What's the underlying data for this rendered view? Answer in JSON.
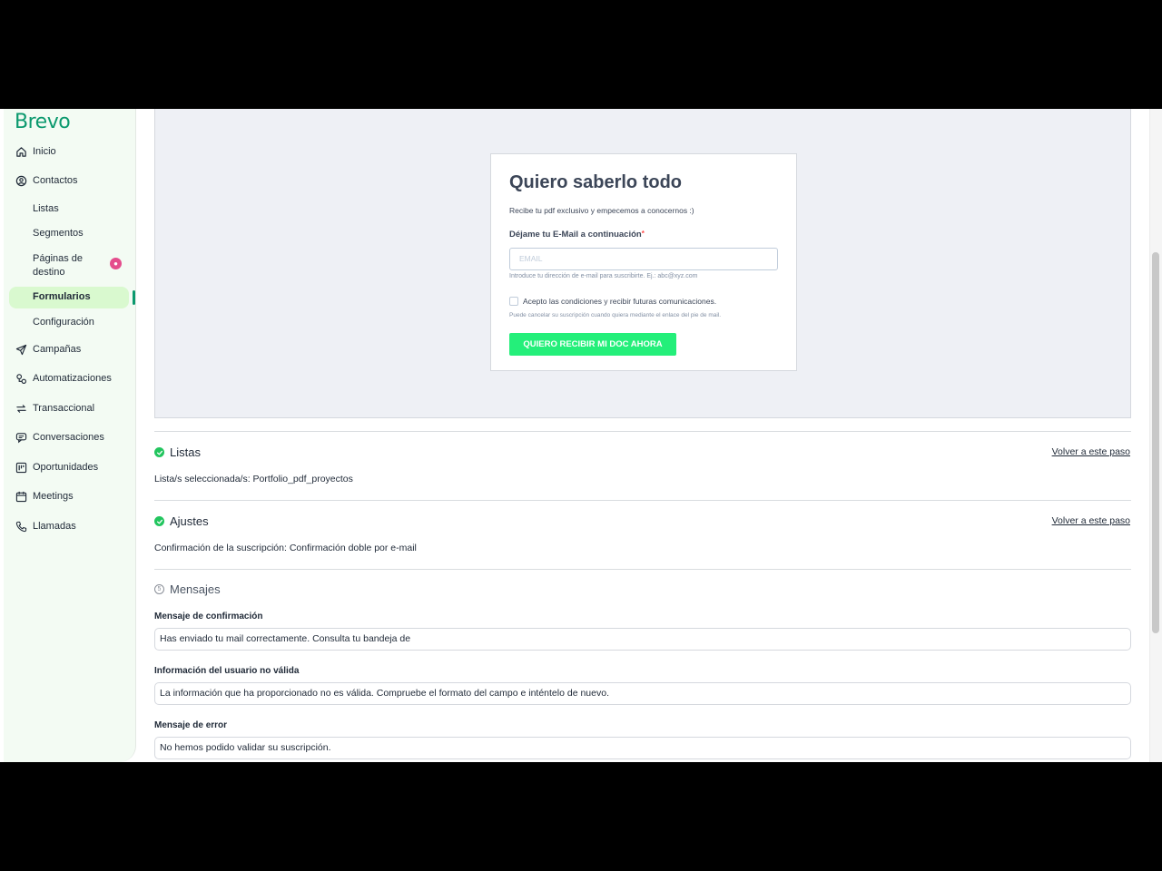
{
  "sidebar": {
    "logo": "Brevo",
    "items": [
      {
        "label": "Inicio",
        "icon": "home-icon"
      },
      {
        "label": "Contactos",
        "icon": "contacts-icon"
      },
      {
        "label": "Campañas",
        "icon": "send-icon"
      },
      {
        "label": "Automatizaciones",
        "icon": "automation-icon"
      },
      {
        "label": "Transaccional",
        "icon": "transactional-icon"
      },
      {
        "label": "Conversaciones",
        "icon": "chat-icon"
      },
      {
        "label": "Oportunidades",
        "icon": "deals-icon"
      },
      {
        "label": "Meetings",
        "icon": "calendar-icon"
      },
      {
        "label": "Llamadas",
        "icon": "phone-icon"
      }
    ],
    "contact_subitems": [
      "Listas",
      "Segmentos",
      "Páginas de destino",
      "Formularios",
      "Configuración"
    ],
    "active_item": "Formularios",
    "accent_color": "#0b996e"
  },
  "preview": {
    "title": "Quiero saberlo todo",
    "subtitle": "Recibe tu pdf exclusivo y empecemos a conocernos :)",
    "email_label": "Déjame tu E-Mail a continuación",
    "required_mark": "*",
    "email_placeholder": "EMAIL",
    "email_help": "Introduce tu dirección de e-mail para suscribirte. Ej.: abc@xyz.com",
    "checkbox_label": "Acepto las condiciones y recibir futuras comunicaciones.",
    "checkbox_help": "Puede cancelar su suscripción cuando quiera mediante el enlace del pie de mail.",
    "submit_label": "QUIERO RECIBIR MI DOC AHORA",
    "button_color": "#24ef7a"
  },
  "sections": {
    "listas": {
      "title": "Listas",
      "back_link": "Volver a este paso",
      "text": "Lista/s seleccionada/s: Portfolio_pdf_proyectos"
    },
    "ajustes": {
      "title": "Ajustes",
      "back_link": "Volver a este paso",
      "text": "Confirmación de la suscripción: Confirmación doble por e-mail"
    },
    "mensajes": {
      "number": "5",
      "title": "Mensajes",
      "fields": [
        {
          "label": "Mensaje de confirmación",
          "value": "Has enviado tu mail correctamente. Consulta tu bandeja de"
        },
        {
          "label": "Información del usuario no válida",
          "value": "La información que ha proporcionado no es válida. Compruebe el formato del campo e inténtelo de nuevo."
        },
        {
          "label": "Mensaje de error",
          "value": "No hemos podido validar su suscripción."
        }
      ]
    }
  }
}
